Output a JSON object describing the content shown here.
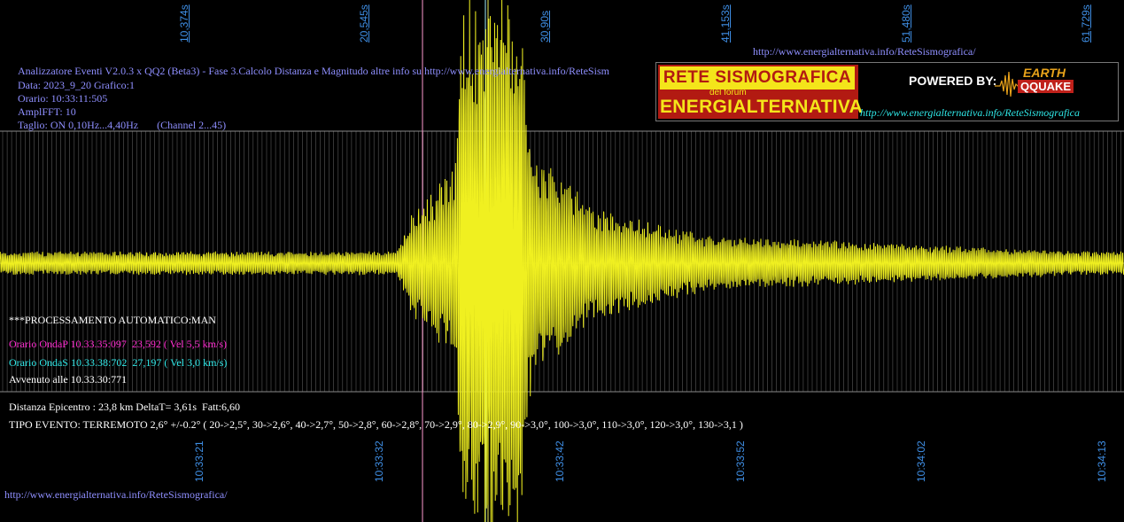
{
  "header": {
    "line1": "Analizzatore Eventi V2.0.3 x QQ2 (Beta3) - Fase 3.Calcolo Distanza e Magnitudo altre info su http://www.energialternativa.info/ReteSism",
    "line2": "Data: 2023_9_20 Grafico:1",
    "line3": "Orario: 10:33:11:505",
    "line4": "AmplFFT: 10",
    "line5": "Taglio: ON 0,10Hz...4,40Hz       (Channel 2...45)"
  },
  "top_url": "http://www.energialternativa.info/ReteSismografica/",
  "bottom_url": "http://www.energialternativa.info/ReteSismografica/",
  "banner": {
    "title": "RETE SISMOGRAFICA",
    "subtitle": "del forum",
    "brand": "ENERGIALTERNATIVA",
    "powered": "POWERED BY:",
    "logo_top": "EARTH",
    "logo_bottom": "QQUAKE",
    "url": "http://www.energialternativa.info/ReteSismografica"
  },
  "info": {
    "processing": "***PROCESSAMENTO AUTOMATICO:MAN",
    "p_wave": "Orario OndaP 10.33.35:097  23,592 ( Vel 5,5 km/s)",
    "s_wave": "Orario OndaS 10.33.38:702  27,197 ( Vel 3,0 km/s)",
    "occurred": "Avvenuto alle 10.33.30:771",
    "distance": "Distanza Epicentro : 23,8 km DeltaT= 3,61s  Fatt:6,60",
    "event_type": "TIPO EVENTO: TERREMOTO 2,6° +/-0.2° ( 20->2,5°, 30->2,6°, 40->2,7°, 50->2,8°, 60->2,8°, 70->2,9°, 80->2,9°, 90->3,0°, 100->3,0°, 110->3,0°, 120->3,0°, 130->3,1 )"
  },
  "colors": {
    "background": "#000000",
    "trace": "#f0f020",
    "grid": "#5a5a5a",
    "marker": "#ff9ad0",
    "axis_text": "#3f8fe6",
    "header_text": "#8f8fff"
  },
  "chart_data": {
    "type": "line",
    "series": [
      {
        "name": "",
        "color": "#f0f020"
      }
    ],
    "x_top_ticks": [
      "10,374s",
      "20,545s",
      "30,90s",
      "41,153s",
      "51,480s",
      "61,729s"
    ],
    "x_bottom_ticks": [
      "10:33:21",
      "10:33:32",
      "10:33:42",
      "10:33:52",
      "10:34:02",
      "10:34:13"
    ],
    "markers": [
      {
        "type": "P-wave",
        "seconds": 23.592
      },
      {
        "type": "S-wave",
        "seconds": 27.197
      }
    ],
    "envelope": [
      {
        "t": 0,
        "amp": 0.05
      },
      {
        "t": 22.5,
        "amp": 0.05
      },
      {
        "t": 23.6,
        "amp": 0.25
      },
      {
        "t": 25.8,
        "amp": 0.4
      },
      {
        "t": 26.2,
        "amp": 1.0
      },
      {
        "t": 29.5,
        "amp": 1.0
      },
      {
        "t": 30.5,
        "amp": 0.5
      },
      {
        "t": 33.5,
        "amp": 0.25
      },
      {
        "t": 40,
        "amp": 0.12
      },
      {
        "t": 52,
        "amp": 0.08
      },
      {
        "t": 62,
        "amp": 0.05
      }
    ],
    "grid": true
  }
}
